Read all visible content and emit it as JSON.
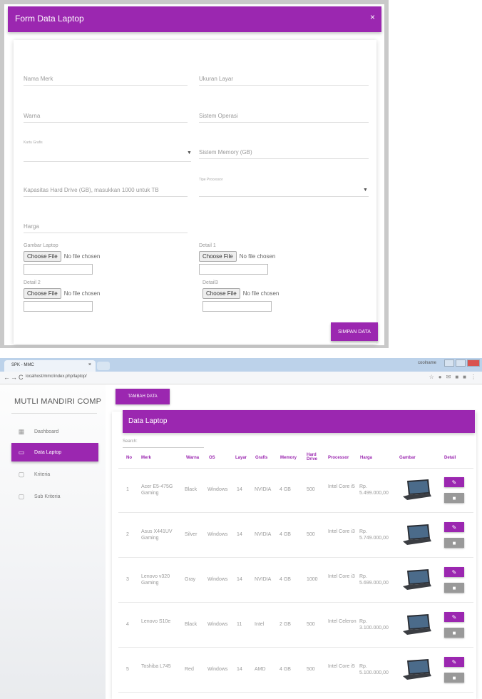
{
  "form": {
    "title": "Form Data Laptop",
    "close_label": "×",
    "fields": {
      "merk": "Nama Merk",
      "ukuran_layar": "Ukuran Layar",
      "warna": "Warna",
      "sistem_operasi": "Sistem Operasi",
      "kartu_grafis_label": "Kartu Grafis",
      "memory": "Sistem Memory (GB)",
      "processor_label": "Tipe Processor",
      "hard_drive": "Kapasitas Hard Drive (GB), masukkan 1000 untuk TB",
      "harga": "Harga"
    },
    "files": {
      "gambar_label": "Gambar Laptop",
      "detail1_label": "Detail 1",
      "detail2_label": "Detail 2",
      "detail3_label": "Detail3",
      "choose_label": "Choose File",
      "no_file": "No file chosen"
    },
    "save_label": "SIMPAN DATA"
  },
  "browser": {
    "tab_title": "SPK - MMC",
    "tab_close": "×",
    "url": "localhost/mmc/index.php/laptop/",
    "user_badge": "coolname",
    "nav_back": "←",
    "nav_forward": "→",
    "nav_reload": "C",
    "ext_icons": [
      "star-icon",
      "chrome-ext-icon",
      "mail-icon",
      "ext-icon",
      "ext-icon",
      "menu-icon"
    ]
  },
  "sidebar": {
    "brand": "MUTLI MANDIRI COMP",
    "items": [
      {
        "label": "Dashboard",
        "icon": "dashboard-icon"
      },
      {
        "label": "Data Laptop",
        "icon": "laptop-icon"
      },
      {
        "label": "Kriteria",
        "icon": "clipboard-icon"
      },
      {
        "label": "Sub Kriteria",
        "icon": "clipboard-icon"
      }
    ]
  },
  "main": {
    "add_button": "TAMBAH DATA",
    "card_title": "Data Laptop",
    "search_label": "Search:",
    "columns": [
      "No",
      "Merk",
      "Warna",
      "OS",
      "Layar",
      "Grafis",
      "Memory",
      "Hard Drive",
      "Processor",
      "Harga",
      "Gambar",
      "Detail"
    ],
    "rows": [
      {
        "no": "1",
        "merk": "Acer E5-475G Gaming",
        "warna": "Black",
        "os": "Windows",
        "layar": "14",
        "grafis": "NVIDIA",
        "memory": "4 GB",
        "hdd": "500",
        "processor": "Intel Core i5",
        "harga": "Rp. 5.499.000,00"
      },
      {
        "no": "2",
        "merk": "Asus X441UV Gaming",
        "warna": "Silver",
        "os": "Windows",
        "layar": "14",
        "grafis": "NVIDIA",
        "memory": "4 GB",
        "hdd": "500",
        "processor": "Intel Core i3",
        "harga": "Rp. 5.749.000,00"
      },
      {
        "no": "3",
        "merk": "Lenovo v320 Gaming",
        "warna": "Gray",
        "os": "Windows",
        "layar": "14",
        "grafis": "NVIDIA",
        "memory": "4 GB",
        "hdd": "1000",
        "processor": "Intel Core i3",
        "harga": "Rp. 5.699.000,00"
      },
      {
        "no": "4",
        "merk": "Lenovo S10e",
        "warna": "Black",
        "os": "Windows",
        "layar": "11",
        "grafis": "Intel",
        "memory": "2 GB",
        "hdd": "500",
        "processor": "Intel Celeron",
        "harga": "Rp. 3.100.000,00"
      },
      {
        "no": "5",
        "merk": "Toshiba L745",
        "warna": "Red",
        "os": "Windows",
        "layar": "14",
        "grafis": "AMD",
        "memory": "4 GB",
        "hdd": "500",
        "processor": "Intel Core i5",
        "harga": "Rp. 5.100.000,00"
      }
    ],
    "edit_icon": "pencil-icon",
    "delete_icon": "trash-icon"
  },
  "colors": {
    "accent": "#9b27b0",
    "text_muted": "#999999"
  }
}
